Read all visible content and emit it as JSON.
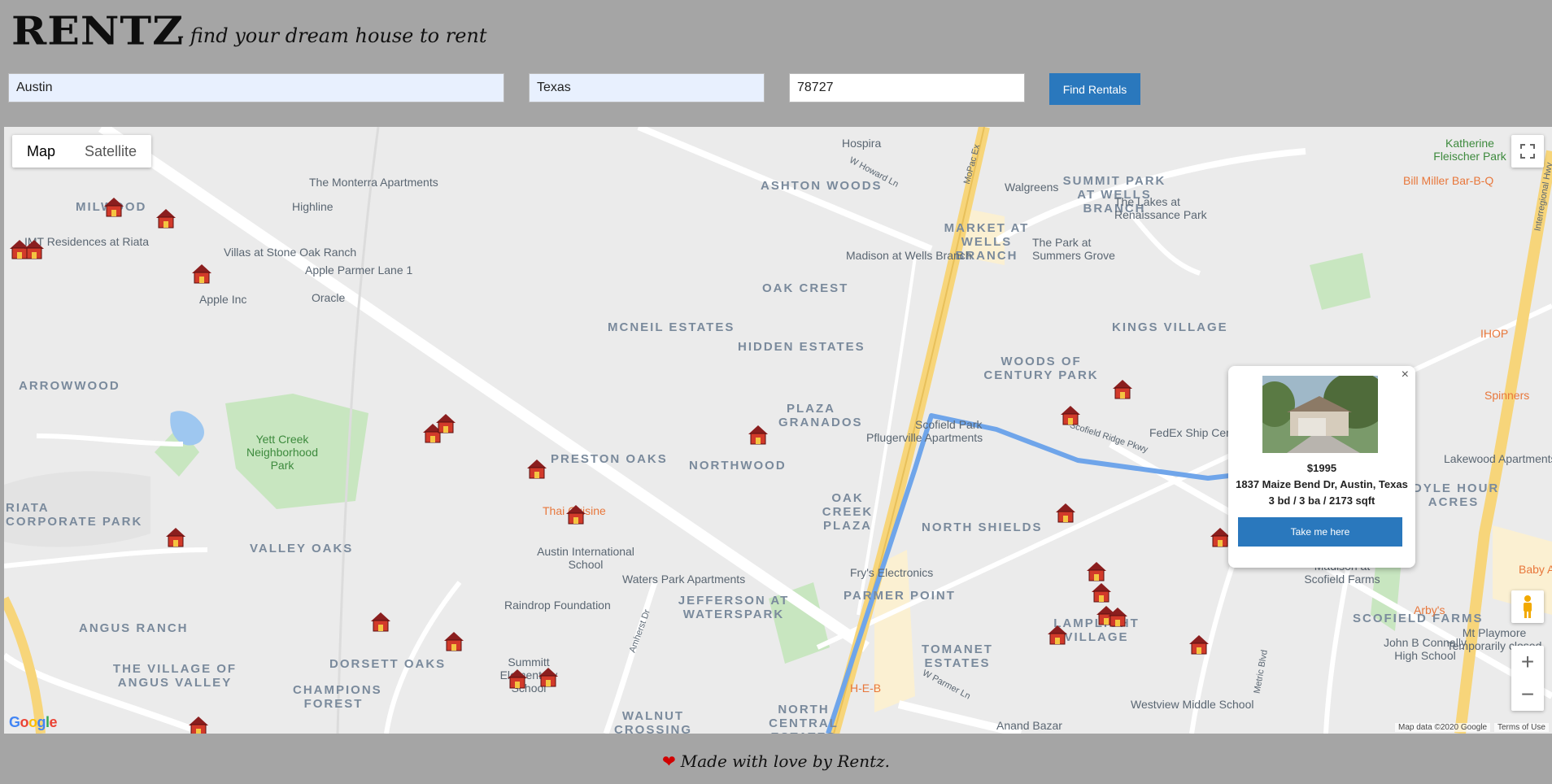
{
  "header": {
    "logo": "RENTZ",
    "tagline": "- find your dream house to rent"
  },
  "search": {
    "city": "Austin",
    "state": "Texas",
    "zip": "78727",
    "button": "Find Rentals"
  },
  "map": {
    "type_options": [
      "Map",
      "Satellite"
    ],
    "active_type": "Map",
    "google_logo": "Google",
    "attribution": "Map data ©2020 Google",
    "terms": "Terms of Use",
    "zoom_in": "+",
    "zoom_out": "−",
    "areas": [
      "MILWOOD",
      "ASHTON WOODS",
      "SUMMIT PARK AT WELLS BRANCH",
      "MARKET AT WELLS BRANCH",
      "OAK CREST",
      "MCNEIL ESTATES",
      "HIDDEN ESTATES",
      "KINGS VILLAGE",
      "WOODS OF CENTURY PARK",
      "ARROWWOOD",
      "PLAZA GRANADOS",
      "PRESTON OAKS",
      "NORTHWOOD",
      "OAK CREEK PLAZA",
      "RIATA CORPORATE PARK",
      "VALLEY OAKS",
      "NORTH SHIELDS",
      "IDYLE HOUR ACRES",
      "PARMER POINT",
      "JEFFERSON AT WATERSPARK",
      "ANGUS RANCH",
      "SCOFIELD FARMS",
      "LAMPLIGHT VILLAGE",
      "DORSETT OAKS",
      "THE VILLAGE OF ANGUS VALLEY",
      "TOMANET ESTATES",
      "CHAMPIONS FOREST",
      "NORTH CENTRAL ESTATES",
      "WALNUT CROSSING"
    ],
    "places": [
      "The Monterra Apartments",
      "Highline",
      "IMT Residences at Riata",
      "Villas at Stone Oak Ranch",
      "Apple Parmer Lane 1",
      "Oracle",
      "Apple Inc",
      "Yett Creek Neighborhood Park",
      "Hospira",
      "Walgreens",
      "Madison at Wells Branch",
      "The Park at Summers Grove",
      "The Lakes at Renaissance Park",
      "Scofield Park",
      "Pflugerville Apartments",
      "FedEx Ship Center",
      "Thai Cuisine",
      "Austin International School",
      "Waters Park Apartments",
      "Raindrop Foundation",
      "Fry's Electronics",
      "Summitt Elementary School",
      "Madison at Scofield Farms",
      "Lakewood Apartments",
      "John B Connally High School",
      "Mt Playmore Temporarily closed",
      "Westview Middle School",
      "Anand Bazar",
      "H-E-B",
      "Katherine Fleischer Park",
      "Bill Miller Bar-B-Q",
      "Spinners",
      "IHOP",
      "Arby's",
      "Baby Ac"
    ],
    "roads": [
      "W Howard Ln",
      "MoPac Ex",
      "Scofield Ridge Pkwy",
      "W Parmer Ln",
      "Amherst Dr",
      "Metric Blvd",
      "Interregional Hwy"
    ]
  },
  "popup": {
    "close": "×",
    "price": "$1995",
    "address": "1837 Maize Bend Dr, Austin, Texas",
    "specs": "3 bd / 3 ba / 2173 sqft",
    "button": "Take me here"
  },
  "footer": {
    "text": "Made with love by Rentz."
  },
  "colors": {
    "bg": "#a5a5a5",
    "button": "#2a78bd",
    "route": "#6fa5ea",
    "highway": "#f7d57a",
    "park": "#c8e6c0",
    "water": "#9ec7f0",
    "marker": "#d23a2a"
  }
}
